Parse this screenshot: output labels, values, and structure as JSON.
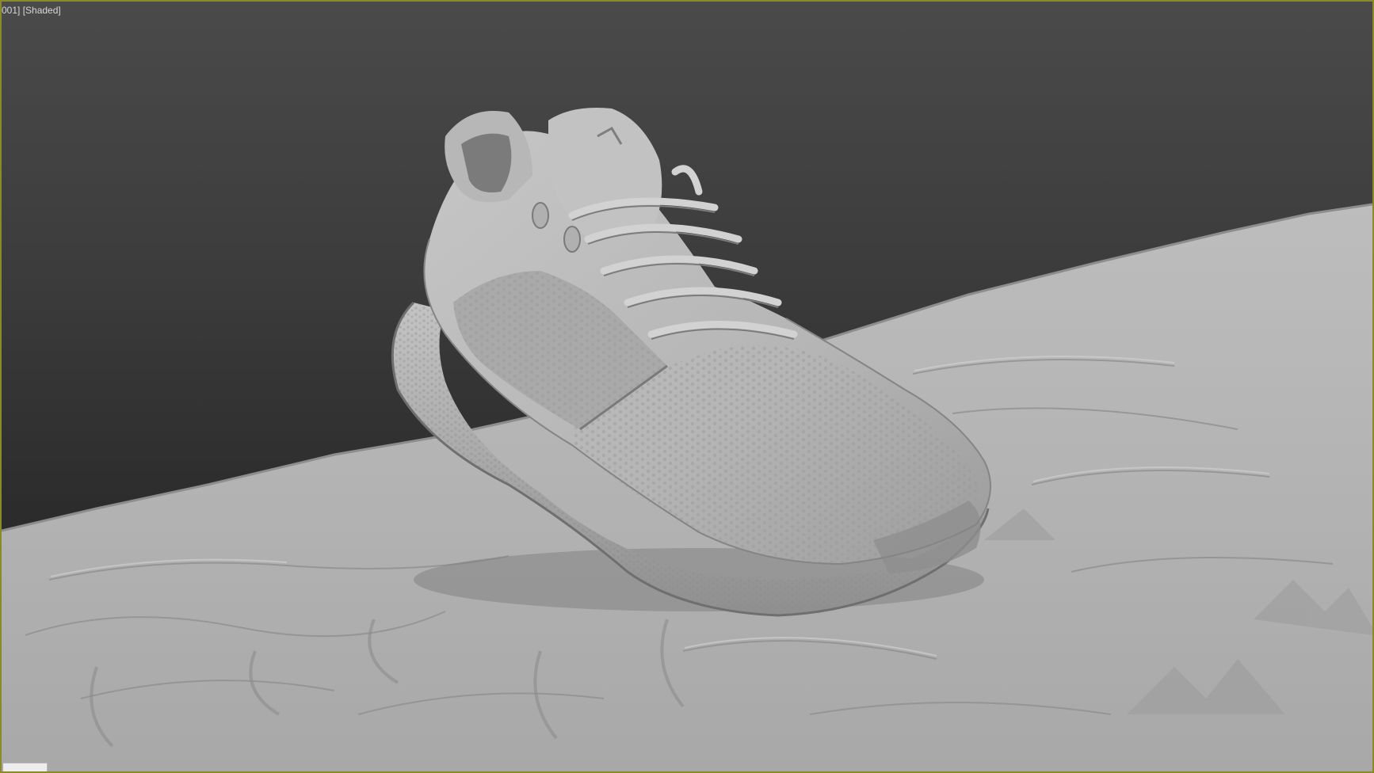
{
  "viewport": {
    "label": "001] [Shaded]"
  },
  "colors": {
    "frame_border": "#8a8a2a",
    "background_top": "#4a4a4a",
    "background_bottom": "#222222",
    "mesh_light": "#c8c8c8",
    "mesh_mid": "#a9a9a9",
    "mesh_dark": "#6e6e6e"
  },
  "scene": {
    "objects": [
      "sneaker-scan-mesh",
      "ground-terrain-mesh"
    ],
    "shading": "shaded"
  }
}
